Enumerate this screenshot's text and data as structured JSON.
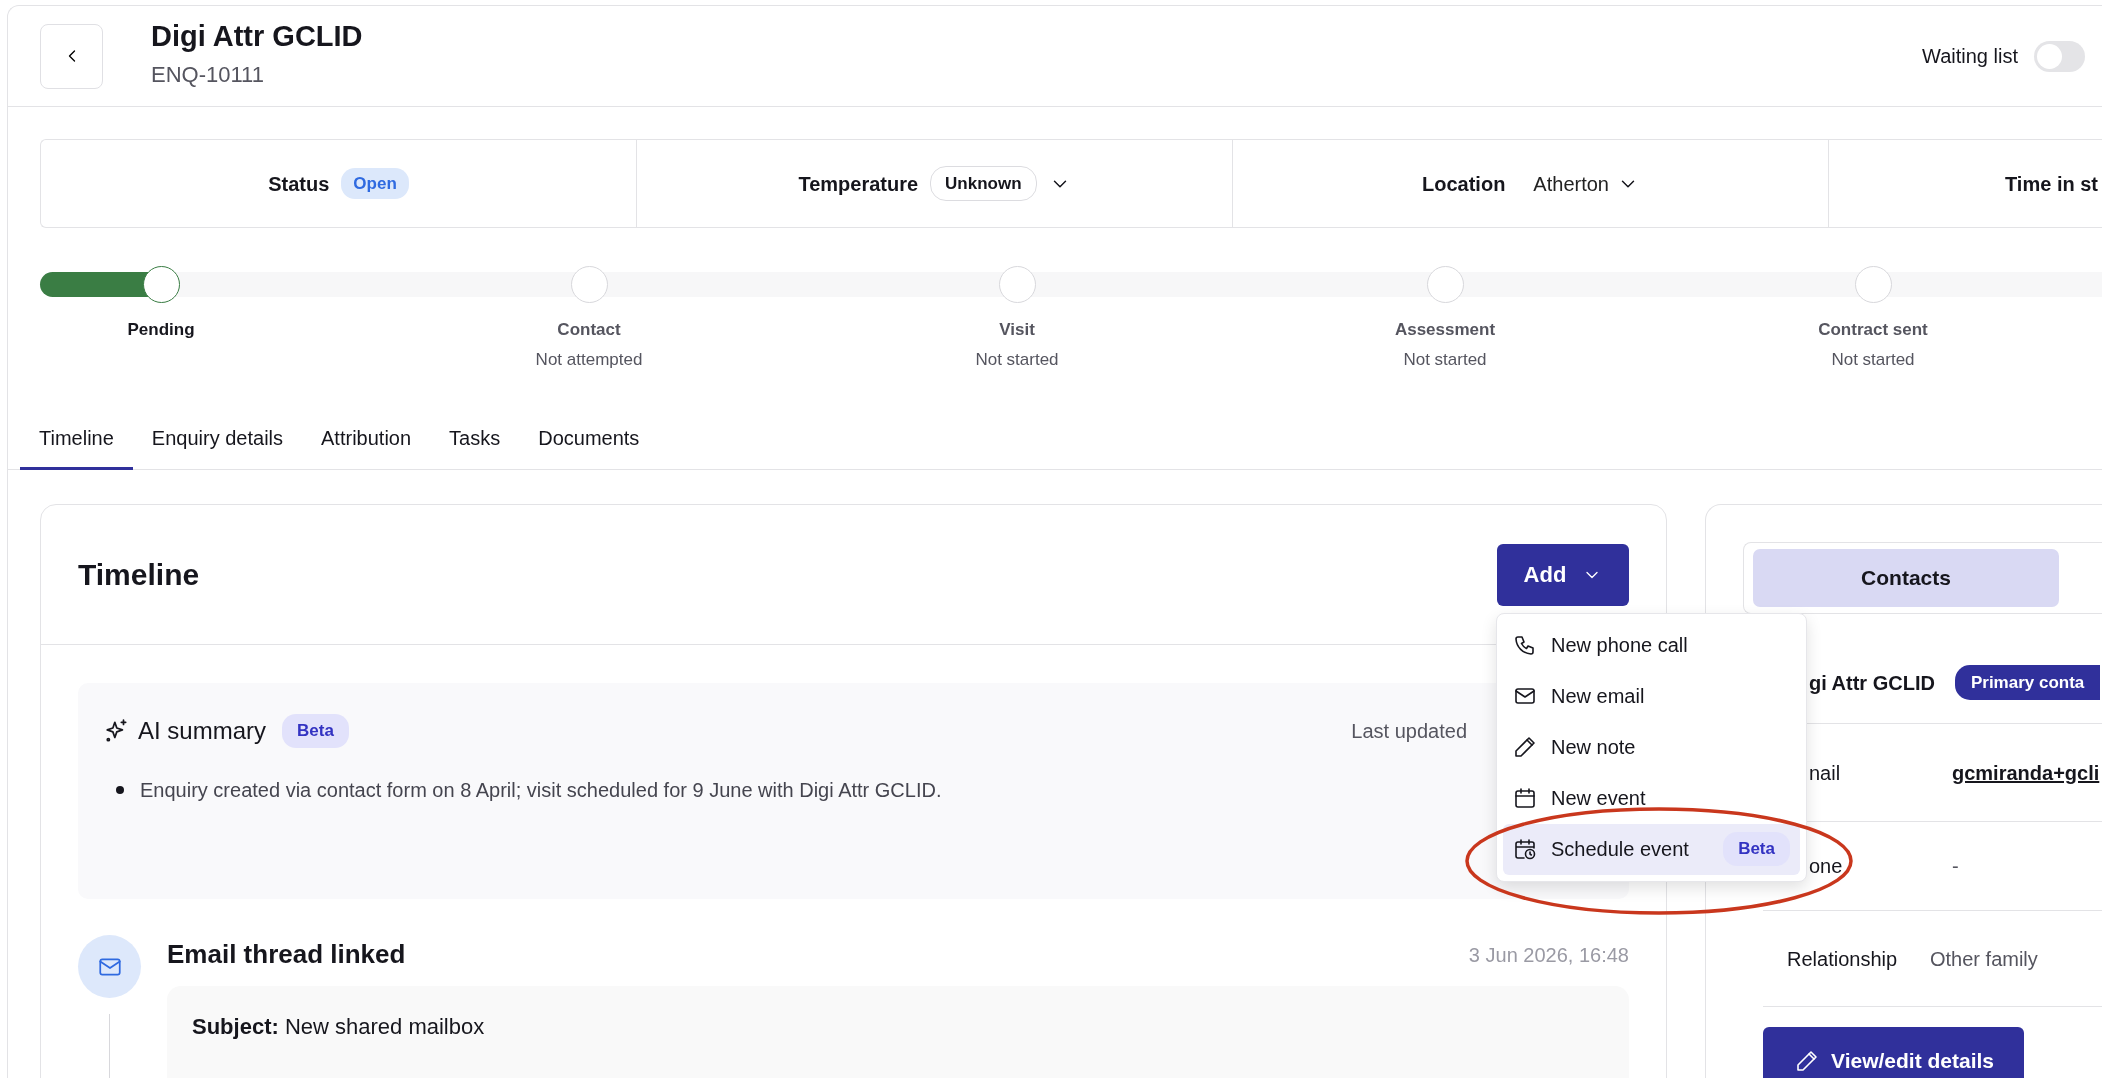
{
  "header": {
    "title": "Digi Attr GCLID",
    "reference": "ENQ-10111",
    "waiting_list": {
      "label": "Waiting list",
      "on": false
    }
  },
  "summary_bar": [
    {
      "label": "Status",
      "value": "Open",
      "kind": "badge"
    },
    {
      "label": "Temperature",
      "value": "Unknown",
      "kind": "pill-select"
    },
    {
      "label": "Location",
      "value": "Atherton",
      "kind": "select"
    },
    {
      "label": "Time in st",
      "kind": "label"
    }
  ],
  "stages": [
    {
      "name": "Pending",
      "current": true
    },
    {
      "name": "Contact",
      "status": "Not attempted",
      "current": false
    },
    {
      "name": "Visit",
      "status": "Not started",
      "current": false
    },
    {
      "name": "Assessment",
      "status": "Not started",
      "current": false
    },
    {
      "name": "Contract sent",
      "status": "Not started",
      "current": false
    }
  ],
  "tabs": [
    {
      "label": "Timeline",
      "selected": true
    },
    {
      "label": "Enquiry details",
      "selected": false
    },
    {
      "label": "Attribution",
      "selected": false
    },
    {
      "label": "Tasks",
      "selected": false
    },
    {
      "label": "Documents",
      "selected": false
    }
  ],
  "timeline": {
    "title": "Timeline",
    "add_button": "Add",
    "ai_summary": {
      "title": "AI summary",
      "badge": "Beta",
      "last_updated": "Last updated",
      "bullets": [
        "Enquiry created via contact form on 8 April; visit scheduled for 9 June with Digi Attr GCLID."
      ]
    },
    "events": [
      {
        "title": "Email thread linked",
        "time": "3 Jun 2026, 16:48",
        "body": "**Subject:** New shared mailbox"
      }
    ]
  },
  "add_menu": {
    "items": [
      {
        "label": "New phone call",
        "highlighted": false
      },
      {
        "label": "New email",
        "highlighted": false
      },
      {
        "label": "New note",
        "highlighted": false
      },
      {
        "label": "New event",
        "highlighted": false
      },
      {
        "label": "Schedule event",
        "badge": "Beta",
        "highlighted": true
      }
    ],
    "annotation_circle": true
  },
  "contacts": {
    "tabs": [
      {
        "label": "Contacts",
        "selected": true
      }
    ],
    "name": "gi Attr GCLID",
    "badge": "Primary conta",
    "fields": [
      {
        "label": "nail",
        "value": "gcmiranda+gcli",
        "kind": "link"
      },
      {
        "label": "one",
        "value": "-",
        "kind": "text"
      },
      {
        "label": "Relationship",
        "value": "Other family",
        "kind": "text"
      }
    ],
    "button": "View/edit details"
  }
}
